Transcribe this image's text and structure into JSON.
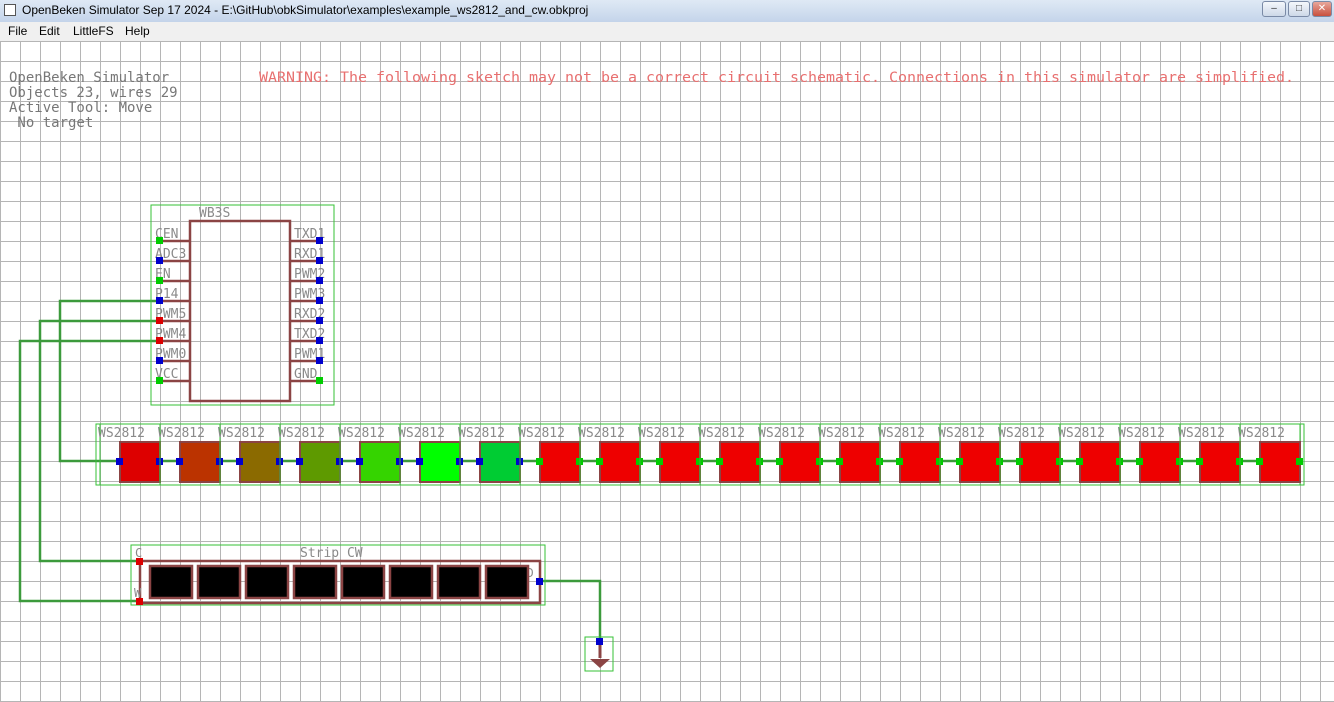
{
  "window": {
    "title": "OpenBeken Simulator Sep 17 2024 - E:\\GitHub\\obkSimulator\\examples\\example_ws2812_and_cw.obkproj",
    "minimize_glyph": "‒",
    "maximize_glyph": "□",
    "close_glyph": "✕"
  },
  "menu": [
    "File",
    "Edit",
    "LittleFS",
    "Help"
  ],
  "status": {
    "app_name": "OpenBeken Simulator",
    "counts": "Objects 23, wires 29",
    "active_tool": "Active Tool: Move",
    "target": " No target"
  },
  "warning": "WARNING: The following sketch may not be a correct circuit schematic. Connections in this simulator are simplified.",
  "chip": {
    "name": "WB3S",
    "left_pins": [
      "CEN",
      "ADC3",
      "EN",
      "P14",
      "PWM5",
      "PWM4",
      "PWM0",
      "VCC"
    ],
    "right_pins": [
      "TXD1",
      "RXD1",
      "PWM2",
      "PWM3",
      "RXD2",
      "TXD2",
      "PWM1",
      "GND"
    ],
    "left_pin_colors": [
      "#00cc00",
      "#0000cc",
      "#00cc00",
      "#0000cc",
      "#dd0000",
      "#dd0000",
      "#0000cc",
      "#00cc00"
    ],
    "right_pin_colors": [
      "#0000cc",
      "#0000cc",
      "#0000cc",
      "#0000cc",
      "#0000cc",
      "#0000cc",
      "#0000cc",
      "#00cc00"
    ]
  },
  "leds": {
    "label": "WS2812",
    "colors": [
      "#dd0000",
      "#bb3300",
      "#8b6a00",
      "#5e9a00",
      "#35d400",
      "#00ff00",
      "#00cc33",
      "#ee0000",
      "#ee0000",
      "#ee0000",
      "#ee0000",
      "#ee0000",
      "#ee0000",
      "#ee0000",
      "#ee0000",
      "#ee0000",
      "#ee0000",
      "#ee0000",
      "#ee0000",
      "#ee0000"
    ]
  },
  "strip": {
    "title": "Strip CW",
    "pin_c": "C",
    "pin_w": "W",
    "pin_gnd": "GND",
    "segment_count": 8
  },
  "theme": {
    "wire": "#3c9a3c",
    "outline_green": "#36c236",
    "body_brown": "#8b4444",
    "label_gray": "#8a8a8a",
    "warning_red": "#e87070",
    "node_blue": "#0000cc",
    "node_green": "#00cc00",
    "node_red": "#dd0000"
  }
}
